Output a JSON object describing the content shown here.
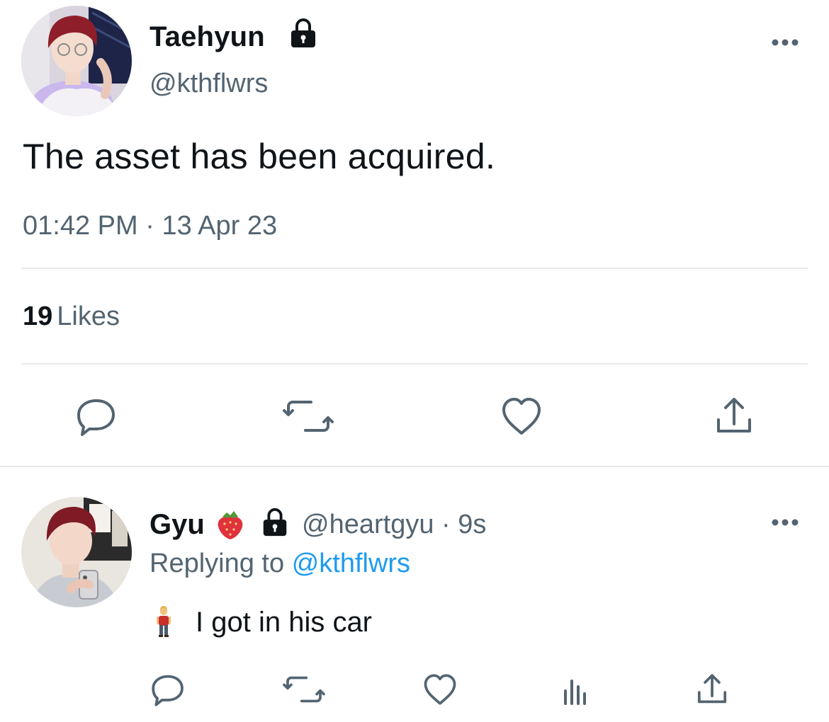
{
  "main_tweet": {
    "display_name": "Taehyun",
    "handle": "@kthflwrs",
    "text": "The asset has been acquired.",
    "time": "01:42 PM",
    "separator": "·",
    "date": "13 Apr 23",
    "likes_count": "19",
    "likes_label": "Likes",
    "icons": {
      "lock": "lock-icon",
      "more": "more-options-icon",
      "reply": "reply-icon",
      "retweet": "retweet-icon",
      "like": "heart-icon",
      "share": "share-icon"
    }
  },
  "reply_tweet": {
    "display_name": "Gyu",
    "name_emoji": "strawberry",
    "handle": "@heartgyu",
    "separator": "·",
    "time_ago": "9s",
    "replying_prefix": "Replying to",
    "replying_to": "@kthflwrs",
    "text_emoji": "person-standing",
    "text": "I got in his car",
    "icons": {
      "lock": "lock-icon",
      "more": "more-options-icon",
      "reply": "reply-icon",
      "retweet": "retweet-icon",
      "like": "heart-icon",
      "views": "views-icon",
      "share": "share-icon"
    }
  },
  "colors": {
    "text_primary": "#0f1419",
    "text_secondary": "#536471",
    "link": "#1d9bf0",
    "divider": "#e6e9ec",
    "icon": "#536471"
  }
}
